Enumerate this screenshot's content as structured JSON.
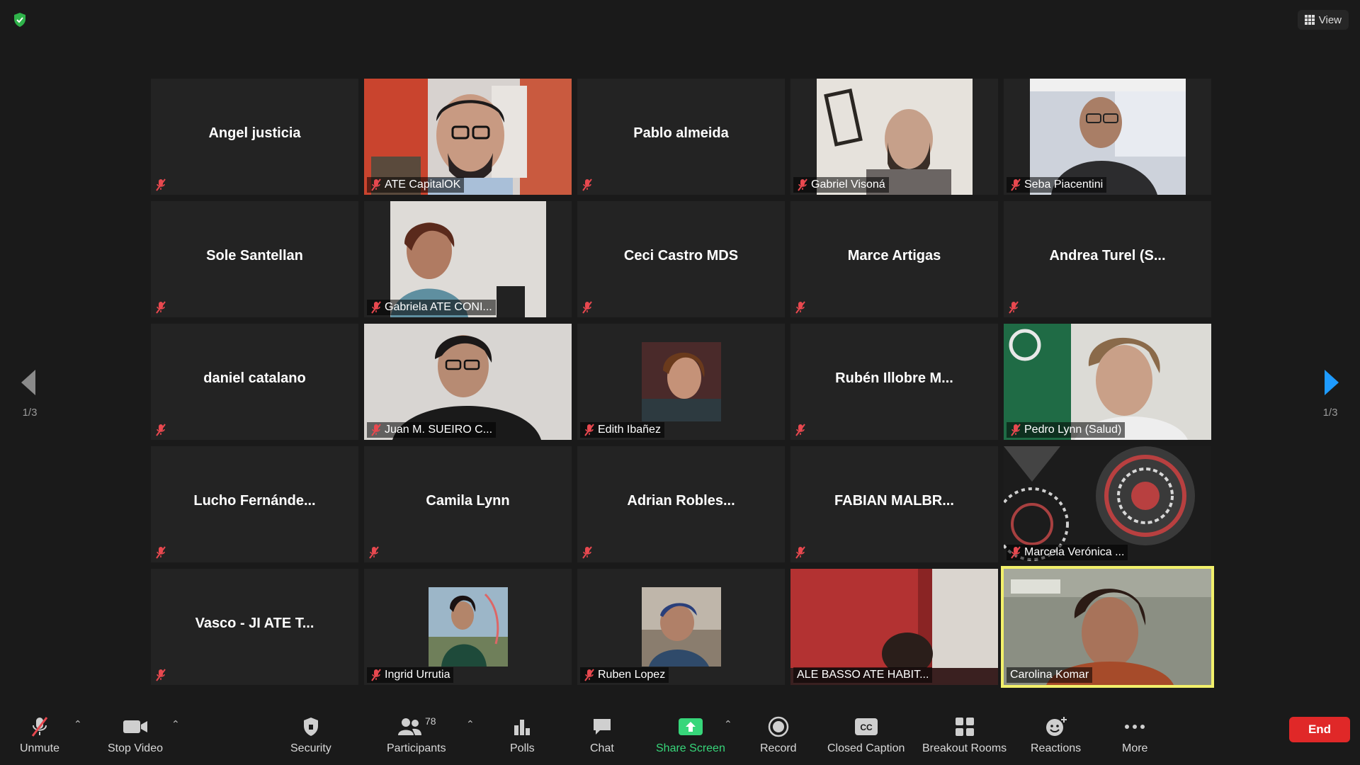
{
  "view": {
    "label": "View"
  },
  "pagination": {
    "left": "1/3",
    "right": "1/3"
  },
  "colors": {
    "active_speaker": "#f2f06b",
    "end_button": "#e02828",
    "share_green": "#37d67a",
    "mute_red": "#e8484f"
  },
  "participants": [
    {
      "name": "Angel justicia",
      "video": false,
      "muted": true
    },
    {
      "name": "ATE CapitalOK",
      "video": true,
      "muted": true
    },
    {
      "name": "Pablo almeida",
      "video": false,
      "muted": true
    },
    {
      "name": "Gabriel Visoná",
      "video": true,
      "muted": true
    },
    {
      "name": "Seba Piacentini",
      "video": true,
      "muted": true
    },
    {
      "name": "Sole Santellan",
      "video": false,
      "muted": true
    },
    {
      "name": "Gabriela ATE CONI...",
      "video": true,
      "muted": true
    },
    {
      "name": "Ceci Castro MDS",
      "video": false,
      "muted": true
    },
    {
      "name": "Marce Artigas",
      "video": false,
      "muted": true
    },
    {
      "name": "Andrea Turel (S...",
      "video": false,
      "muted": true
    },
    {
      "name": "daniel catalano",
      "video": false,
      "muted": true
    },
    {
      "name": "Juan M. SUEIRO C...",
      "video": true,
      "muted": true
    },
    {
      "name": "Edith Ibañez",
      "video": true,
      "muted": true
    },
    {
      "name": "Rubén Illobre M...",
      "video": false,
      "muted": true
    },
    {
      "name": "Pedro Lynn (Salud)",
      "video": true,
      "muted": true
    },
    {
      "name": "Lucho Fernánde...",
      "video": false,
      "muted": true
    },
    {
      "name": "Camila Lynn",
      "video": false,
      "muted": true
    },
    {
      "name": "Adrian Robles...",
      "video": false,
      "muted": true
    },
    {
      "name": "FABIAN MALBR...",
      "video": false,
      "muted": true
    },
    {
      "name": "Marcela Verónica ...",
      "video": true,
      "muted": true
    },
    {
      "name": "Vasco - JI ATE T...",
      "video": false,
      "muted": true
    },
    {
      "name": "Ingrid Urrutia",
      "video": true,
      "muted": true
    },
    {
      "name": "Ruben Lopez",
      "video": true,
      "muted": true
    },
    {
      "name": "ALE BASSO ATE HABIT...",
      "video": true,
      "muted": false
    },
    {
      "name": "Carolina Komar",
      "video": true,
      "muted": false,
      "active_speaker": true
    }
  ],
  "toolbar": {
    "unmute": "Unmute",
    "stop_video": "Stop Video",
    "security": "Security",
    "participants": "Participants",
    "participants_count": "78",
    "polls": "Polls",
    "chat": "Chat",
    "share_screen": "Share Screen",
    "record": "Record",
    "closed_caption": "Closed Caption",
    "breakout_rooms": "Breakout Rooms",
    "reactions": "Reactions",
    "more": "More",
    "end": "End"
  }
}
